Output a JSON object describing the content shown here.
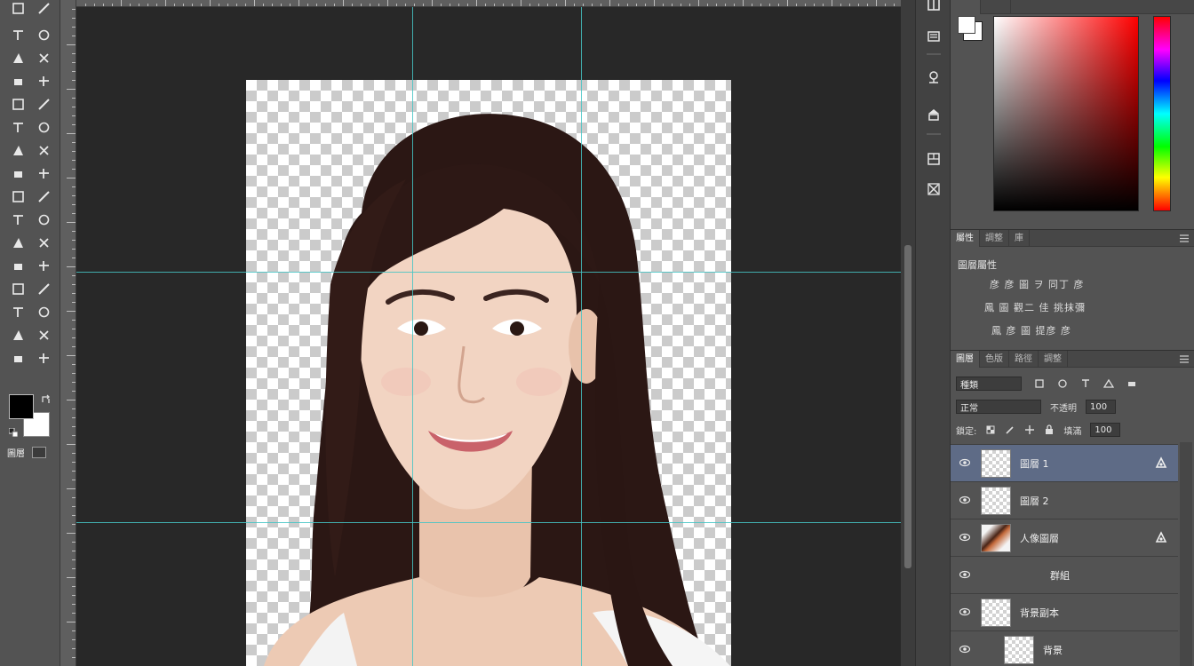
{
  "toolbox": {
    "tools": [
      "ruler-icon",
      "note-icon",
      "brush-icon",
      "mixer-brush-icon",
      "marquee-icon",
      "lasso-icon",
      "move-icon",
      "crop-icon",
      "magic-wand-icon",
      "slice-icon",
      "healing-icon",
      "stamp-icon",
      "history-brush-icon",
      "eraser-icon",
      "bucket-icon",
      "gradient-icon",
      "blur-icon",
      "dodge-icon",
      "pen-icon",
      "type-icon",
      "path-select-icon",
      "shape-icon",
      "hand-icon",
      "zoom-icon",
      "eyedropper-icon",
      "sponge-icon",
      "rotate-view-icon",
      "measure-icon",
      "frame-icon",
      "artboard-icon",
      "select-subject-icon",
      "refine-icon"
    ],
    "mode_label": "圖層",
    "colors": {
      "foreground": "#000000",
      "background": "#ffffff"
    }
  },
  "canvas": {
    "background": "#282828",
    "guide_color": "#45c4c4"
  },
  "icon_strip": {
    "buttons": [
      "character-icon",
      "paragraph-icon",
      "navigator-icon",
      "history-icon",
      "swatches-icon",
      "adjustments-icon"
    ]
  },
  "color_panel": {
    "tabs": [
      "",
      ""
    ],
    "hue": "#ff0000"
  },
  "properties": {
    "tabs": [
      "屬性",
      "調整",
      "庫"
    ],
    "title": "圖層屬性",
    "lines": [
      "彦 彦 圖 ヲ 同丁 彦",
      "鳳 圖 觀二 佳 挑抹彌",
      "鳳 彦 圖 提彦 彦"
    ]
  },
  "layers": {
    "tabs": [
      "圖層",
      "色版",
      "路徑",
      "調整"
    ],
    "filter_kind": "種類",
    "blend_mode": "正常",
    "opacity_label": "不透明",
    "opacity_value": "100",
    "lock_label": "鎖定:",
    "fill_label": "填滿",
    "fill_value": "100",
    "rows": [
      {
        "name": "圖層 1",
        "selected": true,
        "fx": true
      },
      {
        "name": "圖層 2",
        "selected": false,
        "fx": false
      },
      {
        "name": "人像圖層",
        "selected": false,
        "fx": true
      },
      {
        "name": "群組",
        "selected": false,
        "fx": false
      },
      {
        "name": "背景副本",
        "selected": false,
        "fx": false
      },
      {
        "name": "背景",
        "selected": false,
        "fx": false
      }
    ]
  }
}
